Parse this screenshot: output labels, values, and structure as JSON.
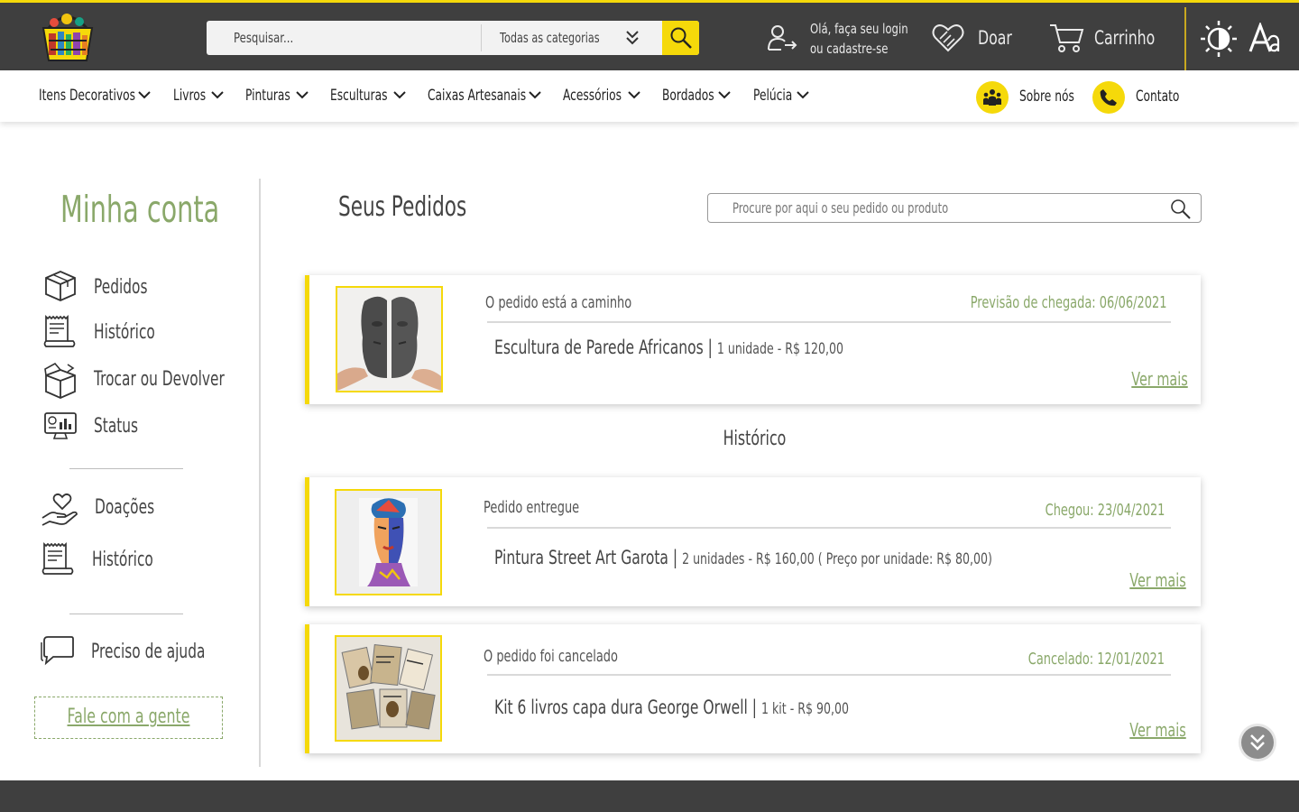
{
  "header": {
    "search_placeholder": "Pesquisar...",
    "category_select": "Todas as categorias",
    "login_line1": "Olá, faça seu login",
    "login_line2": "ou cadastre-se",
    "donate_label": "Doar",
    "cart_label": "Carrinho"
  },
  "nav": {
    "items": [
      {
        "label": "Itens Decorativos"
      },
      {
        "label": "Livros"
      },
      {
        "label": "Pinturas"
      },
      {
        "label": "Esculturas"
      },
      {
        "label": "Caixas Artesanais"
      },
      {
        "label": "Acessórios"
      },
      {
        "label": "Bordados"
      },
      {
        "label": "Pelúcia"
      }
    ],
    "about_label": "Sobre nós",
    "contact_label": "Contato"
  },
  "sidebar": {
    "title": "Minha conta",
    "orders_group": [
      {
        "label": "Pedidos",
        "icon": "box-icon"
      },
      {
        "label": "Histórico",
        "icon": "receipt-icon"
      },
      {
        "label": "Trocar ou Devolver",
        "icon": "open-box-icon"
      },
      {
        "label": "Status",
        "icon": "monitor-chart-icon"
      }
    ],
    "donations_group": [
      {
        "label": "Doações",
        "icon": "heart-hand-icon"
      },
      {
        "label": "Histórico",
        "icon": "receipt-icon"
      }
    ],
    "help_label": "Preciso de ajuda",
    "contact_button": "Fale com a gente"
  },
  "main": {
    "title": "Seus Pedidos",
    "order_search_placeholder": "Procure por aqui o seu pedido ou produto",
    "history_title": "Histórico",
    "current_order": {
      "status": "O pedido está a caminho",
      "date": "Previsão de chegada: 06/06/2021",
      "product": "Escultura de Parede Africanos |",
      "detail": "1 unidade - R$ 120,00",
      "more": "Ver mais"
    },
    "history": [
      {
        "status": "Pedido entregue",
        "date": "Chegou: 23/04/2021",
        "product": "Pintura Street Art Garota |",
        "detail": "2 unidades - R$ 160,00 ( Preço por unidade: R$ 80,00)",
        "more": "Ver mais"
      },
      {
        "status": "O pedido foi cancelado",
        "date": "Cancelado: 12/01/2021",
        "product": "Kit 6 livros capa dura George Orwell  |",
        "detail": "1 kit - R$ 90,00",
        "more": "Ver mais"
      }
    ]
  },
  "colors": {
    "accent_yellow": "#f5d90a",
    "accent_green": "#8aa86a",
    "dark_bar": "#3f3f3f"
  }
}
